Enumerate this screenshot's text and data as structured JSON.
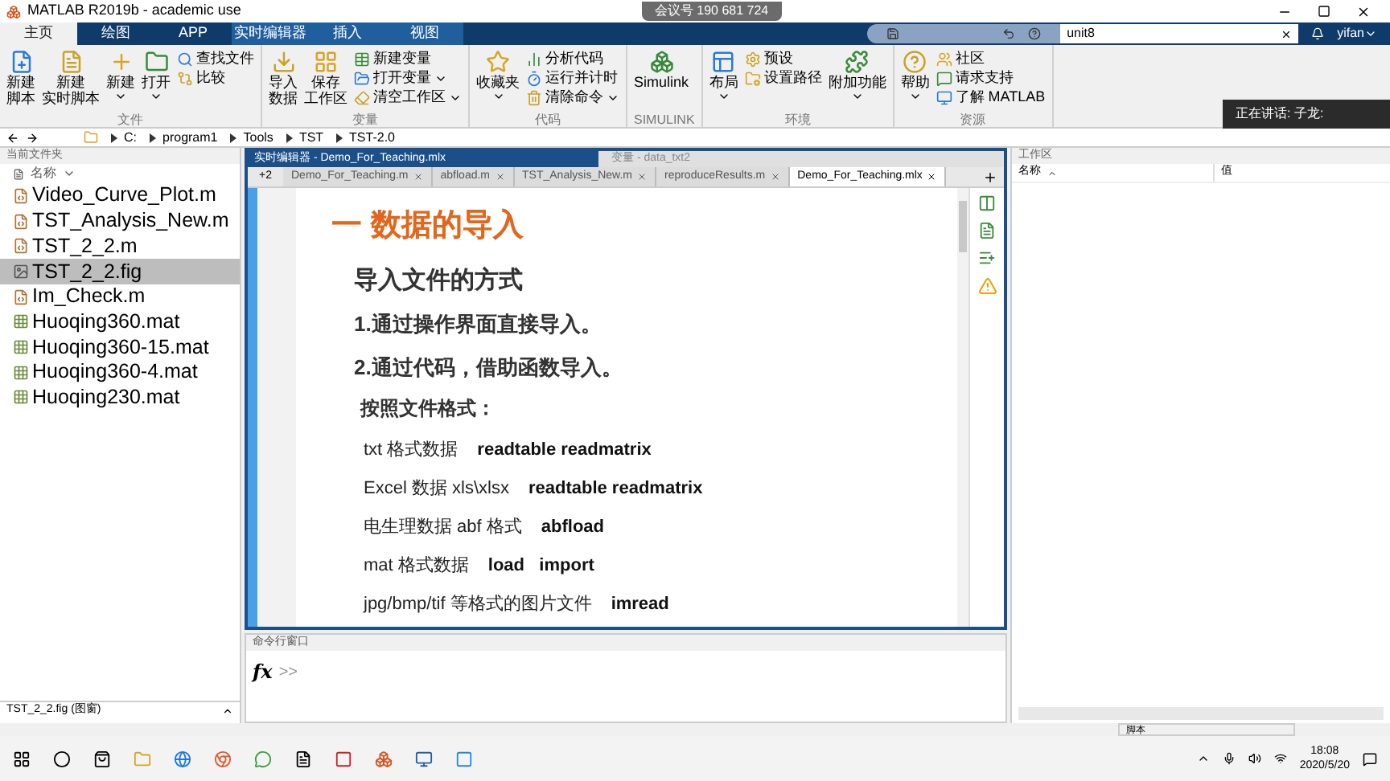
{
  "window": {
    "title": "MATLAB R2019b - academic use"
  },
  "meeting_badge": "会议号 190 681 724",
  "speaker_toast": "正在讲话: 子龙:",
  "tabs": [
    {
      "label": "主页",
      "selected": true
    },
    {
      "label": "绘图",
      "selected": false
    },
    {
      "label": "APP",
      "selected": false
    },
    {
      "label": "实时编辑器",
      "selected": false
    },
    {
      "label": "插入",
      "selected": false
    },
    {
      "label": "视图",
      "selected": false
    }
  ],
  "search": {
    "value": "unit8"
  },
  "user": "yifan",
  "ribbon": {
    "groups": [
      {
        "label": "文件",
        "items": [
          {
            "kind": "large",
            "label": [
              "新建",
              "脚本"
            ],
            "menu": false
          },
          {
            "kind": "large",
            "label": [
              "新建",
              "实时脚本"
            ],
            "menu": false
          },
          {
            "kind": "large",
            "label": "新建",
            "menu": true
          },
          {
            "kind": "large",
            "label": "打开",
            "menu": true
          },
          {
            "kind": "small",
            "label": "查找文件",
            "menu": false
          },
          {
            "kind": "small",
            "label": "比较",
            "menu": false
          }
        ]
      },
      {
        "label": "变量",
        "items": [
          {
            "kind": "large",
            "label": [
              "导入",
              "数据"
            ],
            "menu": false
          },
          {
            "kind": "large",
            "label": [
              "保存",
              "工作区"
            ],
            "menu": false
          },
          {
            "kind": "small",
            "label": "新建变量",
            "menu": false
          },
          {
            "kind": "small",
            "label": "打开变量",
            "menu": true
          },
          {
            "kind": "small",
            "label": "清空工作区",
            "menu": true
          }
        ]
      },
      {
        "label": "代码",
        "items": [
          {
            "kind": "large",
            "label": "收藏夹",
            "menu": true
          },
          {
            "kind": "small",
            "label": "分析代码",
            "menu": false
          },
          {
            "kind": "small",
            "label": "运行并计时",
            "menu": false
          },
          {
            "kind": "small",
            "label": "清除命令",
            "menu": true
          }
        ]
      },
      {
        "label": "SIMULINK",
        "items": [
          {
            "kind": "large",
            "label": "Simulink",
            "menu": false
          }
        ]
      },
      {
        "label": "环境",
        "items": [
          {
            "kind": "large",
            "label": "布局",
            "menu": true
          },
          {
            "kind": "small",
            "label": "预设",
            "menu": false
          },
          {
            "kind": "small",
            "label": "设置路径",
            "menu": false
          },
          {
            "kind": "large",
            "label": "附加功能",
            "menu": true
          }
        ]
      },
      {
        "label": "资源",
        "items": [
          {
            "kind": "large",
            "label": "帮助",
            "menu": true
          },
          {
            "kind": "small",
            "label": "社区",
            "menu": false
          },
          {
            "kind": "small",
            "label": "请求支持",
            "menu": false
          },
          {
            "kind": "small",
            "label": "了解 MATLAB",
            "menu": false
          }
        ]
      }
    ]
  },
  "address": [
    "C:",
    "program1",
    "Tools",
    "TST",
    "TST-2.0"
  ],
  "current_folder": {
    "title": "当前文件夹",
    "column": "名称",
    "files": [
      {
        "name": "Video_Curve_Plot.m",
        "kind": "script",
        "selected": false
      },
      {
        "name": "TST_Analysis_New.m",
        "kind": "script",
        "selected": false
      },
      {
        "name": "TST_2_2.m",
        "kind": "script",
        "selected": false
      },
      {
        "name": "TST_2_2.fig",
        "kind": "figure",
        "selected": true
      },
      {
        "name": "Im_Check.m",
        "kind": "script",
        "selected": false
      },
      {
        "name": "Huoqing360.mat",
        "kind": "data",
        "selected": false
      },
      {
        "name": "Huoqing360-15.mat",
        "kind": "data",
        "selected": false
      },
      {
        "name": "Huoqing360-4.mat",
        "kind": "data",
        "selected": false
      },
      {
        "name": "Huoqing230.mat",
        "kind": "data",
        "selected": false
      }
    ],
    "details": "TST_2_2.fig  (图窗)"
  },
  "editor": {
    "title": "实时编辑器 - Demo_For_Teaching.mlx",
    "variable_tab": "变量 - data_txt2",
    "overflow": "+2",
    "tabs": [
      {
        "label": "Demo_For_Teaching.m",
        "selected": false
      },
      {
        "label": "abfload.m",
        "selected": false
      },
      {
        "label": "TST_Analysis_New.m",
        "selected": false
      },
      {
        "label": "reproduceResults.m",
        "selected": false
      },
      {
        "label": "Demo_For_Teaching.mlx",
        "selected": true
      }
    ],
    "lines": [
      {
        "kind": "heading",
        "text": "一 数据的导入"
      },
      {
        "kind": "subheading",
        "text": "导入文件的方式"
      },
      {
        "kind": "item",
        "text": "1.通过操作界面直接导入。"
      },
      {
        "kind": "item",
        "text": "2.通过代码，借助函数导入。"
      },
      {
        "kind": "label",
        "text": "按照文件格式："
      },
      {
        "kind": "format",
        "text": "txt 格式数据",
        "functions": "readtable readmatrix"
      },
      {
        "kind": "format",
        "text": "Excel 数据 xls\\xlsx",
        "functions": "readtable readmatrix"
      },
      {
        "kind": "format",
        "text": "电生理数据 abf 格式",
        "functions": "abfload"
      },
      {
        "kind": "format",
        "text": "mat 格式数据",
        "functions": "load   import"
      },
      {
        "kind": "format",
        "text": "jpg/bmp/tif 等格式的图片文件",
        "functions": "imread"
      }
    ]
  },
  "command_window": {
    "title": "命令行窗口",
    "fx": "fx",
    "prompt": ">>"
  },
  "workspace": {
    "title": "工作区",
    "columns": [
      "名称",
      "值"
    ]
  },
  "status_bar": {
    "mode": "脚本"
  },
  "taskbar": {
    "time": "18:08",
    "date": "2020/5/20"
  }
}
